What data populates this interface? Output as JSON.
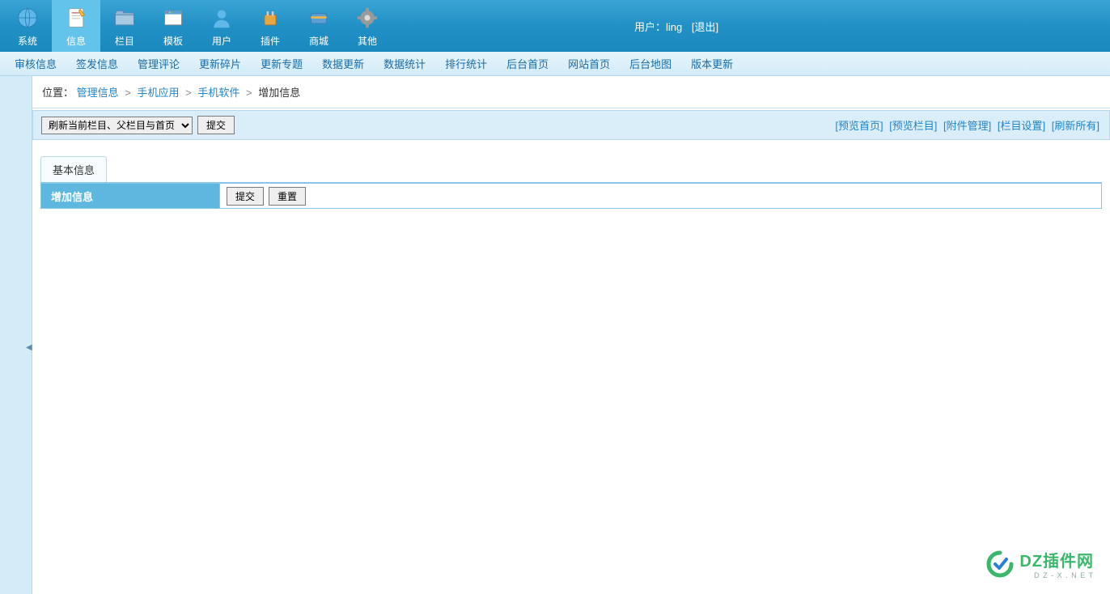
{
  "topNav": {
    "items": [
      {
        "label": "系统",
        "icon": "globe"
      },
      {
        "label": "信息",
        "icon": "document",
        "active": true
      },
      {
        "label": "栏目",
        "icon": "folder"
      },
      {
        "label": "模板",
        "icon": "window"
      },
      {
        "label": "用户",
        "icon": "user"
      },
      {
        "label": "插件",
        "icon": "plugin"
      },
      {
        "label": "商城",
        "icon": "shop"
      },
      {
        "label": "其他",
        "icon": "gear"
      }
    ],
    "userLabel": "用户：",
    "userName": "ling",
    "logout": "[退出]"
  },
  "subNav": [
    "审核信息",
    "签发信息",
    "管理评论",
    "更新碎片",
    "更新专题",
    "数据更新",
    "数据统计",
    "排行统计",
    "后台首页",
    "网站首页",
    "后台地图",
    "版本更新"
  ],
  "breadcrumb": {
    "prefix": "位置：",
    "items": [
      "管理信息",
      "手机应用",
      "手机软件"
    ],
    "current": "增加信息",
    "sep": ">"
  },
  "actionBar": {
    "selectOption": "刷新当前栏目、父栏目与首页",
    "submitBtn": "提交",
    "links": [
      "[预览首页]",
      "[预览栏目]",
      "[附件管理]",
      "[栏目设置]",
      "[刷新所有]"
    ]
  },
  "tabs": [
    "基本信息"
  ],
  "form": {
    "title": "增加信息",
    "submitBtn": "提交",
    "resetBtn": "重置"
  },
  "watermark": {
    "main": "DZ插件网",
    "sub": "D Z - X . N E T"
  }
}
